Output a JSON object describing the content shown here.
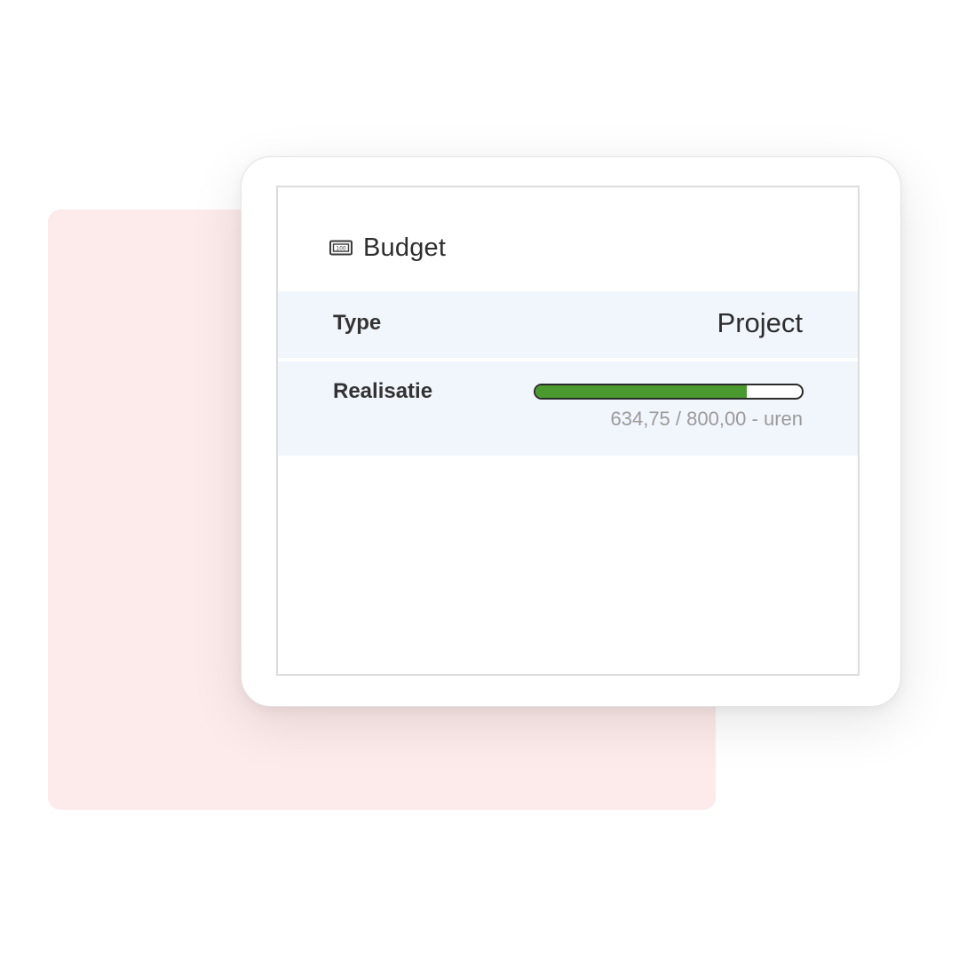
{
  "colors": {
    "backdrop": "#fdeaea",
    "row_background": "#f1f6fc",
    "progress_fill": "#4a9a2f",
    "muted_text": "#9a9a9a"
  },
  "panel": {
    "icon": "money-bill-icon",
    "title": "Budget"
  },
  "rows": {
    "type": {
      "label": "Type",
      "value": "Project"
    },
    "realisatie": {
      "label": "Realisatie",
      "progress_fraction": 0.7934,
      "progress_text": "634,75 / 800,00 - uren"
    }
  }
}
